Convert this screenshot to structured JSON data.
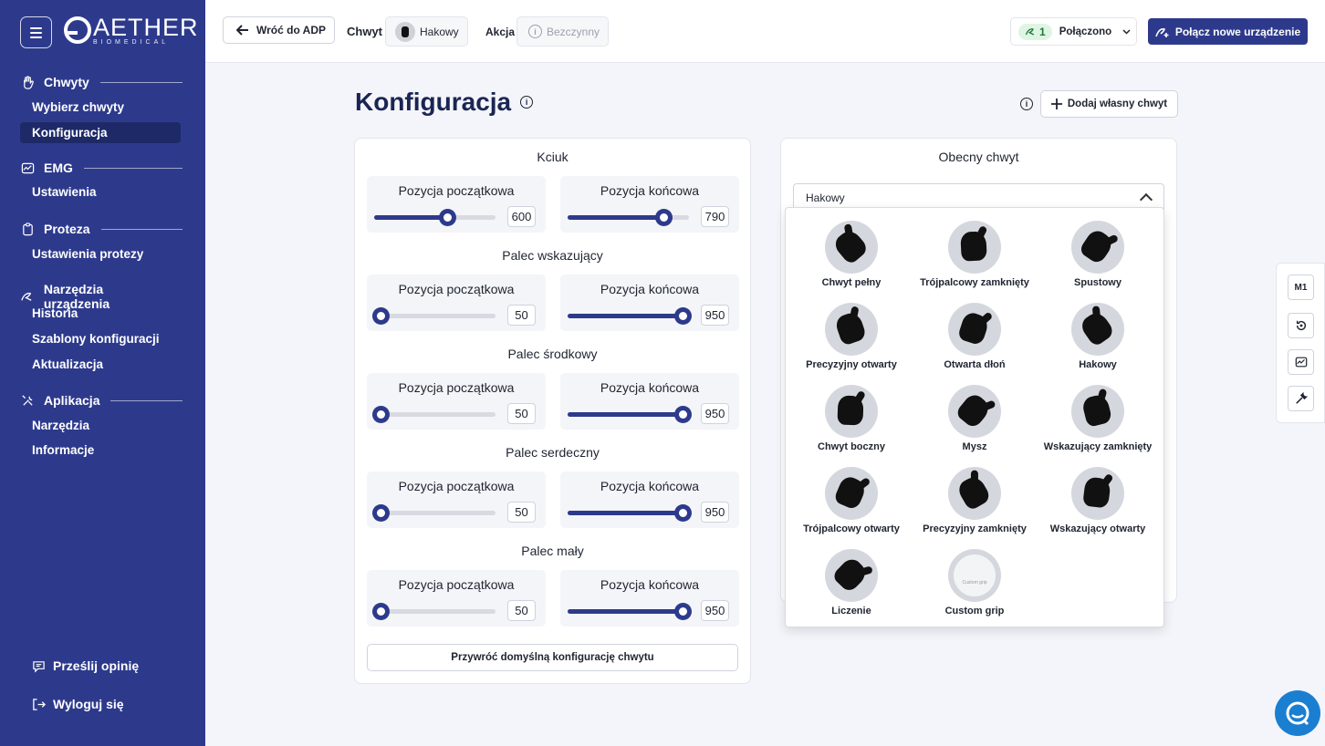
{
  "brand": {
    "name": "AETHER",
    "sub": "BIOMEDICAL"
  },
  "sidebar": {
    "sections": [
      {
        "title": "Chwyty",
        "items": [
          "Wybierz chwyty",
          "Konfiguracja"
        ]
      },
      {
        "title": "EMG",
        "items": [
          "Ustawienia"
        ]
      },
      {
        "title": "Proteza",
        "items": [
          "Ustawienia protezy"
        ]
      },
      {
        "title": "Narzędzia urządzenia",
        "items": [
          "Historia",
          "Szablony konfiguracji",
          "Aktualizacja"
        ]
      },
      {
        "title": "Aplikacja",
        "items": [
          "Narzędzia",
          "Informacje"
        ]
      }
    ],
    "active_item": "Konfiguracja",
    "footer": {
      "feedback": "Prześlij opinię",
      "logout": "Wyloguj się"
    }
  },
  "topbar": {
    "back_label": "Wróć do ADP",
    "grip_label": "Chwyt",
    "grip_value": "Hakowy",
    "action_label": "Akcja",
    "action_value": "Bezczynny",
    "connection_count": "1",
    "connection_status": "Połączono",
    "connect_new_label": "Połącz nowe urządzenie"
  },
  "main": {
    "title": "Konfiguracja",
    "add_grip_label": "Dodaj własny chwyt",
    "reset_label": "Przywróć domyślną konfigurację chwytu",
    "start_label": "Pozycja początkowa",
    "end_label": "Pozycja końcowa",
    "fingers": [
      {
        "name": "Kciuk",
        "start": 600,
        "end": 790
      },
      {
        "name": "Palec wskazujący",
        "start": 50,
        "end": 950
      },
      {
        "name": "Palec środkowy",
        "start": 50,
        "end": 950
      },
      {
        "name": "Palec serdeczny",
        "start": 50,
        "end": 950
      },
      {
        "name": "Palec mały",
        "start": 50,
        "end": 950
      }
    ],
    "slider_max": 1000
  },
  "current_grip": {
    "title": "Obecny chwyt",
    "selected": "Hakowy",
    "options": [
      "Chwyt pełny",
      "Trójpalcowy zamknięty",
      "Spustowy",
      "Precyzyjny otwarty",
      "Otwarta dłoń",
      "Hakowy",
      "Chwyt boczny",
      "Mysz",
      "Wskazujący zamknięty",
      "Trójpalcowy otwarty",
      "Precyzyjny zamknięty",
      "Wskazujący otwarty",
      "Liczenie",
      "Custom grip"
    ],
    "custom_inner_text": "Custom grip"
  },
  "right_tools": {
    "m1_label": "M1"
  },
  "colors": {
    "primary": "#2d3a8c",
    "active_nav": "#1e2968",
    "chat": "#1a7fd1",
    "connected": "#1d7a35"
  }
}
